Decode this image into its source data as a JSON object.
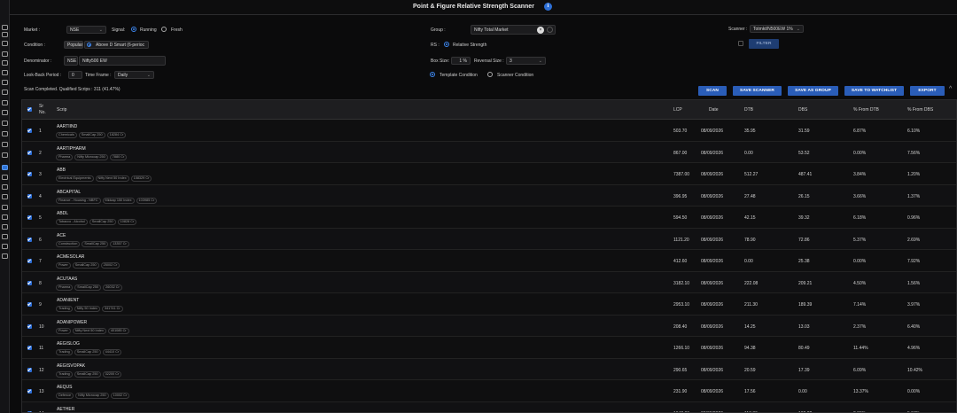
{
  "title": "Point & Figure Relative Strength Scanner",
  "info_icon": "info-icon",
  "form": {
    "market_label": "Market :",
    "market_value": "NSE",
    "signal_label": "Signal:",
    "signal_running": "Running",
    "signal_fresh": "Fresh",
    "condition_label": "Condition :",
    "condition_type": "Popular",
    "condition_value": "Above D Smart (6-perioc",
    "denominator_label": "Denominator :",
    "denominator_exchange": "NSE",
    "denominator_value": "Nifty500 EW",
    "lookback_label": "Look-Back Period :",
    "lookback_value": "0",
    "timeframe_label": "Time Frame :",
    "timeframe_value": "Daily",
    "group_label": "Group :",
    "group_value": "Nifty Total Market",
    "rs_label": "RS :",
    "rs_option": "Relative Strength",
    "boxsize_label": "Box Size:",
    "boxsize_value": "1",
    "boxsize_unit": "%",
    "reversal_label": "Reversal Size :",
    "reversal_value": "3",
    "template_condition": "Template Condition",
    "scanner_condition": "Scanner Condition",
    "scanner_label": "Scanner :",
    "scanner_value": "Totmkt/N500EW 1%",
    "filter_label": "FILTER"
  },
  "status": "Scan Completed. Qualified Scrips : 311 (41.47%)",
  "actions": {
    "scan": "SCAN",
    "save_scanner": "SAVE SCANNER",
    "save_as_group": "SAVE AS GROUP",
    "save_to_watchlist": "SAVE TO WATCHLIST",
    "export": "EXPORT",
    "collapse": "^"
  },
  "table": {
    "headers": {
      "sr": "Sr",
      "no": "No.",
      "scrip": "Scrip",
      "lcp": "LCP",
      "date": "Date",
      "dtb": "DTB",
      "dbs": "DBS",
      "pct_dtb": "% From DTB",
      "pct_dbs": "% From DBS"
    },
    "rows": [
      {
        "sr": "1",
        "scrip": "AARTIIND",
        "tags": [
          "Chemicals",
          "SmallCap 250",
          "18284 Cr"
        ],
        "lcp": "503.70",
        "date": "08/09/2026",
        "dtb": "35.95",
        "dbs": "31.59",
        "pct_dtb": "6.87%",
        "pct_dbs": "6.10%"
      },
      {
        "sr": "2",
        "scrip": "AARTIPHARM",
        "tags": [
          "Pharma",
          "Nifty Microcap 250",
          "7880 Cr"
        ],
        "lcp": "867.00",
        "date": "08/09/2026",
        "dtb": "0.00",
        "dbs": "53.52",
        "pct_dtb": "0.00%",
        "pct_dbs": "7.56%"
      },
      {
        "sr": "3",
        "scrip": "ABB",
        "tags": [
          "Electrical Equipments",
          "Nifty Next 50 Index",
          "158329 Cr"
        ],
        "lcp": "7387.00",
        "date": "08/09/2026",
        "dtb": "512.27",
        "dbs": "487.41",
        "pct_dtb": "3.84%",
        "pct_dbs": "1.20%"
      },
      {
        "sr": "4",
        "scrip": "ABCAPITAL",
        "tags": [
          "Finance - Housing - NBFC",
          "Midcap 150 Index",
          "103985 Cr"
        ],
        "lcp": "396.95",
        "date": "08/09/2026",
        "dtb": "27.48",
        "dbs": "26.15",
        "pct_dtb": "3.66%",
        "pct_dbs": "1.37%"
      },
      {
        "sr": "5",
        "scrip": "ABDL",
        "tags": [
          "Tobacco - Alcohol",
          "SmallCap 250",
          "10828 Cr"
        ],
        "lcp": "594.50",
        "date": "08/09/2026",
        "dtb": "42.15",
        "dbs": "39.32",
        "pct_dtb": "6.18%",
        "pct_dbs": "0.96%"
      },
      {
        "sr": "6",
        "scrip": "ACE",
        "tags": [
          "Construction",
          "SmallCap 250",
          "13357 Cr"
        ],
        "lcp": "1121.20",
        "date": "08/09/2026",
        "dtb": "78.90",
        "dbs": "72.86",
        "pct_dtb": "5.37%",
        "pct_dbs": "2.69%"
      },
      {
        "sr": "7",
        "scrip": "ACMESOLAR",
        "tags": [
          "Power",
          "SmallCap 250",
          "25002 Cr"
        ],
        "lcp": "412.60",
        "date": "08/09/2026",
        "dtb": "0.00",
        "dbs": "25.38",
        "pct_dtb": "0.00%",
        "pct_dbs": "7.92%"
      },
      {
        "sr": "8",
        "scrip": "ACUTAAS",
        "tags": [
          "Pharma",
          "SmallCap 250",
          "26032 Cr"
        ],
        "lcp": "3182.10",
        "date": "08/09/2026",
        "dtb": "222.08",
        "dbs": "209.21",
        "pct_dtb": "4.50%",
        "pct_dbs": "1.56%"
      },
      {
        "sr": "9",
        "scrip": "ADANIENT",
        "tags": [
          "Trading",
          "Nifty 50 Index",
          "341741 Cr"
        ],
        "lcp": "2953.10",
        "date": "08/09/2026",
        "dtb": "211.30",
        "dbs": "189.39",
        "pct_dtb": "7.14%",
        "pct_dbs": "3.97%"
      },
      {
        "sr": "10",
        "scrip": "ADANIPOWER",
        "tags": [
          "Power",
          "Nifty Next 50 Index",
          "401085 Cr"
        ],
        "lcp": "208.40",
        "date": "08/09/2026",
        "dtb": "14.25",
        "dbs": "13.03",
        "pct_dtb": "2.37%",
        "pct_dbs": "6.40%"
      },
      {
        "sr": "11",
        "scrip": "AEGISLOG",
        "tags": [
          "Trading",
          "SmallCap 250",
          "44410 Cr"
        ],
        "lcp": "1266.10",
        "date": "08/09/2026",
        "dtb": "94.38",
        "dbs": "80.49",
        "pct_dtb": "11.44%",
        "pct_dbs": "4.96%"
      },
      {
        "sr": "12",
        "scrip": "AEGISVOPAK",
        "tags": [
          "Trading",
          "SmallCap 250",
          "32200 Cr"
        ],
        "lcp": "290.65",
        "date": "08/09/2026",
        "dtb": "20.59",
        "dbs": "17.39",
        "pct_dtb": "6.09%",
        "pct_dbs": "10.42%"
      },
      {
        "sr": "13",
        "scrip": "AEQUS",
        "tags": [
          "Defence",
          "Nifty Microcap 250",
          "10002 Cr"
        ],
        "lcp": "231.90",
        "date": "08/09/2026",
        "dtb": "17.56",
        "dbs": "0.00",
        "pct_dtb": "13.37%",
        "pct_dbs": "0.00%"
      },
      {
        "sr": "14",
        "scrip": "AETHER",
        "tags": [],
        "lcp": "1642.00",
        "date": "08/09/2026",
        "dtb": "113.89",
        "dbs": "102.22",
        "pct_dtb": "2.89%",
        "pct_dbs": "5.97%"
      }
    ]
  }
}
